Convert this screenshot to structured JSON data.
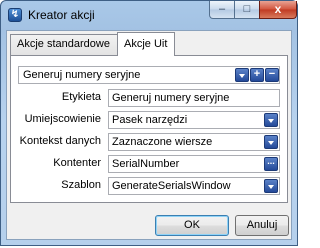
{
  "window": {
    "title": "Kreator akcji"
  },
  "titlebar_buttons": {
    "minimize": "–",
    "maximize": "□",
    "close": "x"
  },
  "tabs": [
    {
      "label": "Akcje standardowe"
    },
    {
      "label": "Akcje Uit"
    }
  ],
  "action_select": {
    "value": "Generuj numery seryjne",
    "add_label": "+",
    "remove_label": "−"
  },
  "fields": [
    {
      "label": "Etykieta",
      "value": "Generuj numery seryjne"
    },
    {
      "label": "Umiejscowienie",
      "value": "Pasek narzędzi"
    },
    {
      "label": "Kontekst danych",
      "value": "Zaznaczone wiersze"
    },
    {
      "label": "Kontenter",
      "value": "SerialNumber",
      "button_label": "..."
    },
    {
      "label": "Szablon",
      "value": "GenerateSerialsWindow"
    }
  ],
  "buttons": {
    "ok": "OK",
    "cancel": "Anuluj"
  },
  "icons": {
    "app": "app-icon",
    "dropdown": "chevron-down-icon",
    "add": "plus-icon",
    "remove": "minus-icon",
    "browse": "ellipsis-icon"
  },
  "colors": {
    "title_bg": "#a9c8e8",
    "accent_button": "#244a99",
    "close_button": "#c03a22"
  }
}
